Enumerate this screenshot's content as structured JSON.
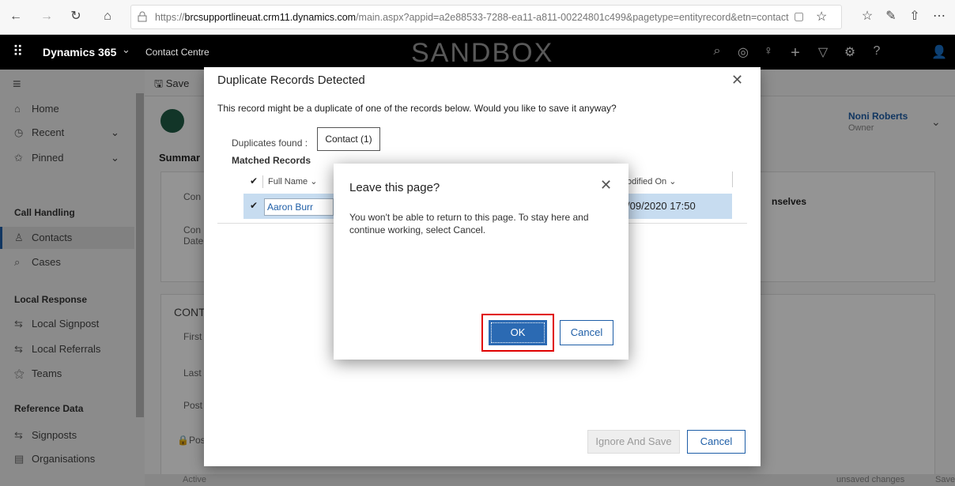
{
  "browser": {
    "url_prefix": "https://",
    "url_domain": "brcsupportlineuat.crm11.dynamics.com",
    "url_path": "/main.aspx?appid=a2e88533-7288-ea11-a811-00224801c499&pagetype=entityrecord&etn=contact",
    "icons": {
      "back": "←",
      "forward": "→",
      "refresh": "↻",
      "home": "⌂",
      "lock": "🔒",
      "reader": "▢",
      "star": "☆",
      "favorites": "☆",
      "pen": "✎",
      "share": "⇧",
      "more": "⋯"
    }
  },
  "app": {
    "waffle": "⠿",
    "name": "Dynamics 365",
    "name_chevron": "⌄",
    "area": "Contact Centre",
    "watermark": "SANDBOX",
    "header_icons": [
      "⌕",
      "◎",
      "♀",
      "+",
      "▽",
      "⚙",
      "?",
      "👤"
    ]
  },
  "sidebar": {
    "hamburger": "≡",
    "top_items": [
      {
        "icon": "⌂",
        "label": "Home"
      },
      {
        "icon": "◷",
        "label": "Recent",
        "chev": "⌄"
      },
      {
        "icon": "✩",
        "label": "Pinned",
        "chev": "⌄"
      }
    ],
    "groups": {
      "call_handling": "Call Handling",
      "local_response": "Local Response",
      "reference_data": "Reference Data"
    },
    "call_items": [
      {
        "icon": "♙",
        "label": "Contacts"
      },
      {
        "icon": "⌕",
        "label": "Cases"
      }
    ],
    "local_items": [
      {
        "icon": "⇆",
        "label": "Local Signpost"
      },
      {
        "icon": "⇆",
        "label": "Local Referrals"
      },
      {
        "icon": "⚝",
        "label": "Teams"
      }
    ],
    "ref_items": [
      {
        "icon": "⇆",
        "label": "Signposts"
      },
      {
        "icon": "▤",
        "label": "Organisations"
      }
    ]
  },
  "form": {
    "save_label": "Save",
    "summary_tab": "Summar",
    "owner_name": "Noni Roberts",
    "owner_role": "Owner",
    "section_text": "nselves",
    "contact_section": "CONTA",
    "field_labels": [
      "Con",
      "Con",
      "Date",
      "First",
      "Last",
      "Post",
      "Post"
    ],
    "status": "Active",
    "unsaved": "unsaved changes",
    "footer_save": "Save"
  },
  "duplicate_dialog": {
    "title": "Duplicate Records Detected",
    "message": "This record might be a duplicate of one of the records below. Would you like to save it anyway?",
    "duplicates_found_label": "Duplicates found :",
    "duplicates_found_value": "Contact (1)",
    "matched_records": "Matched Records",
    "col_full_name": "Full Name",
    "col_modified_on": "odified On",
    "row_name": "Aaron Burr",
    "row_modified": "/09/2020 17:50",
    "ignore_save": "Ignore And Save",
    "cancel": "Cancel"
  },
  "leave_dialog": {
    "title": "Leave this page?",
    "message": "You won't be able to return to this page. To stay here and continue working, select Cancel.",
    "ok": "OK",
    "cancel": "Cancel"
  },
  "colors": {
    "accent": "#1e5ea7",
    "ok_button": "#2b6ab3",
    "highlight": "#e00000",
    "selected_row": "#c7dcf0"
  }
}
